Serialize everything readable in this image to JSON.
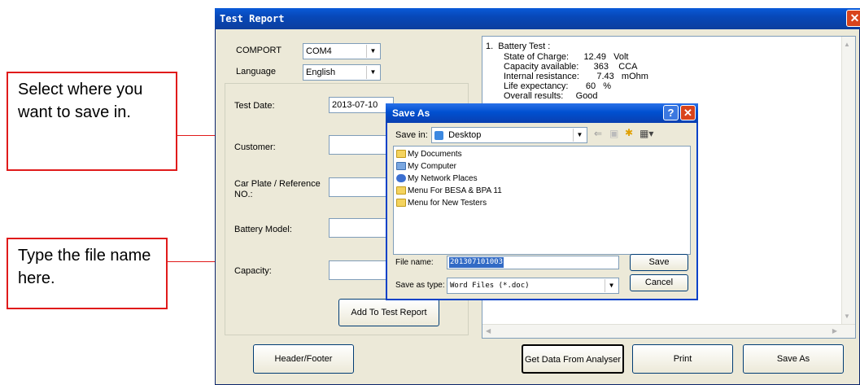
{
  "callouts": {
    "save_in": "Select where you want to save in.",
    "file_name": "Type the file name here."
  },
  "window": {
    "title": "Test Report",
    "close": "✕",
    "comport_label": "COMPORT",
    "comport_value": "COM4",
    "language_label": "Language",
    "language_value": "English",
    "test_date_label": "Test Date:",
    "test_date_value": "2013-07-10",
    "customer_label": "Customer:",
    "car_plate_label": "Car Plate / Reference NO.:",
    "battery_model_label": "Battery Model:",
    "capacity_label": "Capacity:",
    "add_button": "Add To Test Report",
    "report_lines": [
      "1.  Battery Test :",
      "State of Charge:      12.49   Volt",
      "Capacity available:      363    CCA",
      "Internal resistance:       7.43   mOhm",
      "Life expectancy:       60   %",
      "Overall results:     Good"
    ],
    "header_footer": "Header/Footer",
    "get_data": "Get Data From Analyser",
    "print": "Print",
    "save_as": "Save As"
  },
  "dialog": {
    "title": "Save As",
    "help": "?",
    "close": "✕",
    "save_in_label": "Save in:",
    "save_in_value": "Desktop",
    "items": [
      "My Documents",
      "My Computer",
      "My Network Places",
      "Menu For BESA & BPA 11",
      "Menu for New Testers"
    ],
    "file_name_label": "File name:",
    "file_name_value": "201307101003",
    "save_type_label": "Save as type:",
    "save_type_value": "Word Files (*.doc)",
    "save_button": "Save",
    "cancel_button": "Cancel"
  }
}
